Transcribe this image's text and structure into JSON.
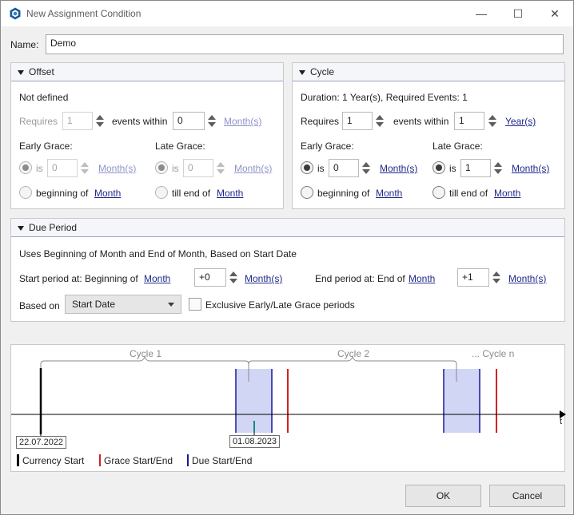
{
  "window": {
    "title": "New Assignment Condition",
    "controls": {
      "minimize": "—",
      "maximize": "☐",
      "close": "✕"
    }
  },
  "name": {
    "label": "Name:",
    "value": "Demo"
  },
  "offset": {
    "title": "Offset",
    "status": "Not defined",
    "requires_label": "Requires",
    "requires_value": "1",
    "events_within_label": "events within",
    "events_within_value": "0",
    "unit": "Month(s)",
    "early_grace_label": "Early Grace:",
    "late_grace_label": "Late Grace:",
    "is_label": "is",
    "early_value": "0",
    "late_value": "0",
    "beginning_of_label": "beginning of",
    "till_end_of_label": "till end of",
    "month_link": "Month"
  },
  "cycle": {
    "title": "Cycle",
    "summary": "Duration: 1 Year(s), Required Events: 1",
    "requires_label": "Requires",
    "requires_value": "1",
    "events_within_label": "events within",
    "events_within_value": "1",
    "unit": "Year(s)",
    "early_grace_label": "Early Grace:",
    "late_grace_label": "Late Grace:",
    "is_label": "is",
    "early_value": "0",
    "late_value": "1",
    "grace_unit": "Month(s)",
    "beginning_of_label": "beginning of",
    "till_end_of_label": "till end of",
    "month_link": "Month"
  },
  "due_period": {
    "title": "Due Period",
    "summary": "Uses Beginning of Month and End of Month, Based on Start Date",
    "start_label": "Start period at: Beginning of",
    "start_link": "Month",
    "start_value": "+0",
    "start_unit": "Month(s)",
    "end_label": "End period at: End of",
    "end_link": "Month",
    "end_value": "+1",
    "end_unit": "Month(s)",
    "based_on_label": "Based on",
    "based_on_value": "Start Date",
    "exclusive_label": "Exclusive Early/Late Grace periods",
    "exclusive_checked": false
  },
  "timeline": {
    "cycle1": "Cycle 1",
    "cycle2": "Cycle 2",
    "cyclen": "... Cycle n",
    "axis_label": "t",
    "date_start": "22.07.2022",
    "date_due": "01.08.2023",
    "legend": [
      {
        "label": "Currency Start",
        "color": "#000000"
      },
      {
        "label": "Grace Start/End",
        "color": "#d42020"
      },
      {
        "label": "Due Start/End",
        "color": "#1a1a9a"
      }
    ],
    "due_fill": "#d2d6f5"
  },
  "buttons": {
    "ok": "OK",
    "cancel": "Cancel"
  }
}
